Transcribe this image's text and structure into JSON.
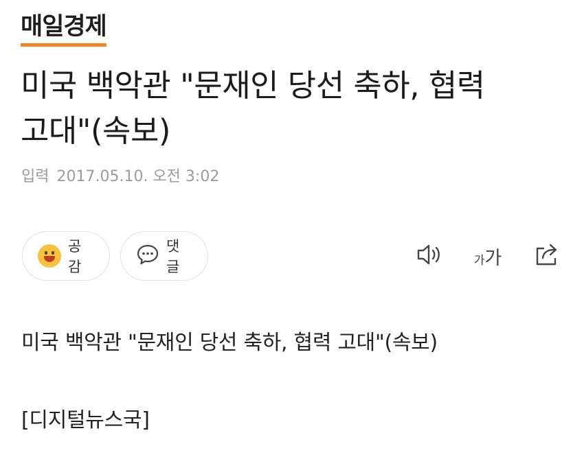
{
  "brand": {
    "logo_text": "매일경제",
    "accent_color": "#f4861f"
  },
  "article": {
    "headline_line1": "미국 백악관 \"문재인 당선 축하, 협력",
    "headline_line2": "고대\"(속보)",
    "published_label": "입력",
    "published_at": "2017.05.10. 오전 3:02",
    "body_line1": "미국 백악관 \"문재인 당선 축하, 협력 고대\"(속보)",
    "body_line2": "[디지털뉴스국]"
  },
  "actions": {
    "like_label": "공감",
    "comment_label": "댓글",
    "fontsize_small": "가",
    "fontsize_large": "가",
    "icons": [
      "smile-emoji-icon",
      "speech-bubble-icon",
      "speaker-icon",
      "font-size-icon",
      "share-icon"
    ]
  }
}
